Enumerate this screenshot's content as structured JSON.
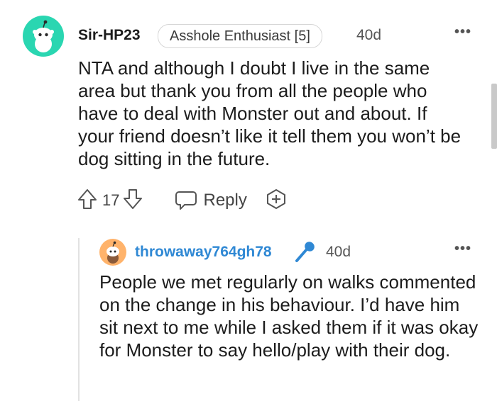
{
  "comment": {
    "username": "Sir-HP23",
    "flair": "Asshole Enthusiast [5]",
    "age": "40d",
    "more": "•••",
    "body": "NTA and although I doubt I live in the same area but thank you from all the people who have to deal with Monster out and about. If your friend doesn’t like it tell them you won’t be dog sitting in the future.",
    "votes": "17",
    "reply_label": "Reply",
    "avatar_color": "#2ad6b1"
  },
  "reply": {
    "username": "throwaway764gh78",
    "age": "40d",
    "more": "•••",
    "body": "People we met regularly on walks commented on the change in his behaviour. I’d have him sit next to me while I asked them if it was okay for Monster to say hello/play with their dog.",
    "avatar_color": "#ffb36b",
    "username_color": "#2f88d4",
    "op_badge_icon": "microphone-icon"
  }
}
